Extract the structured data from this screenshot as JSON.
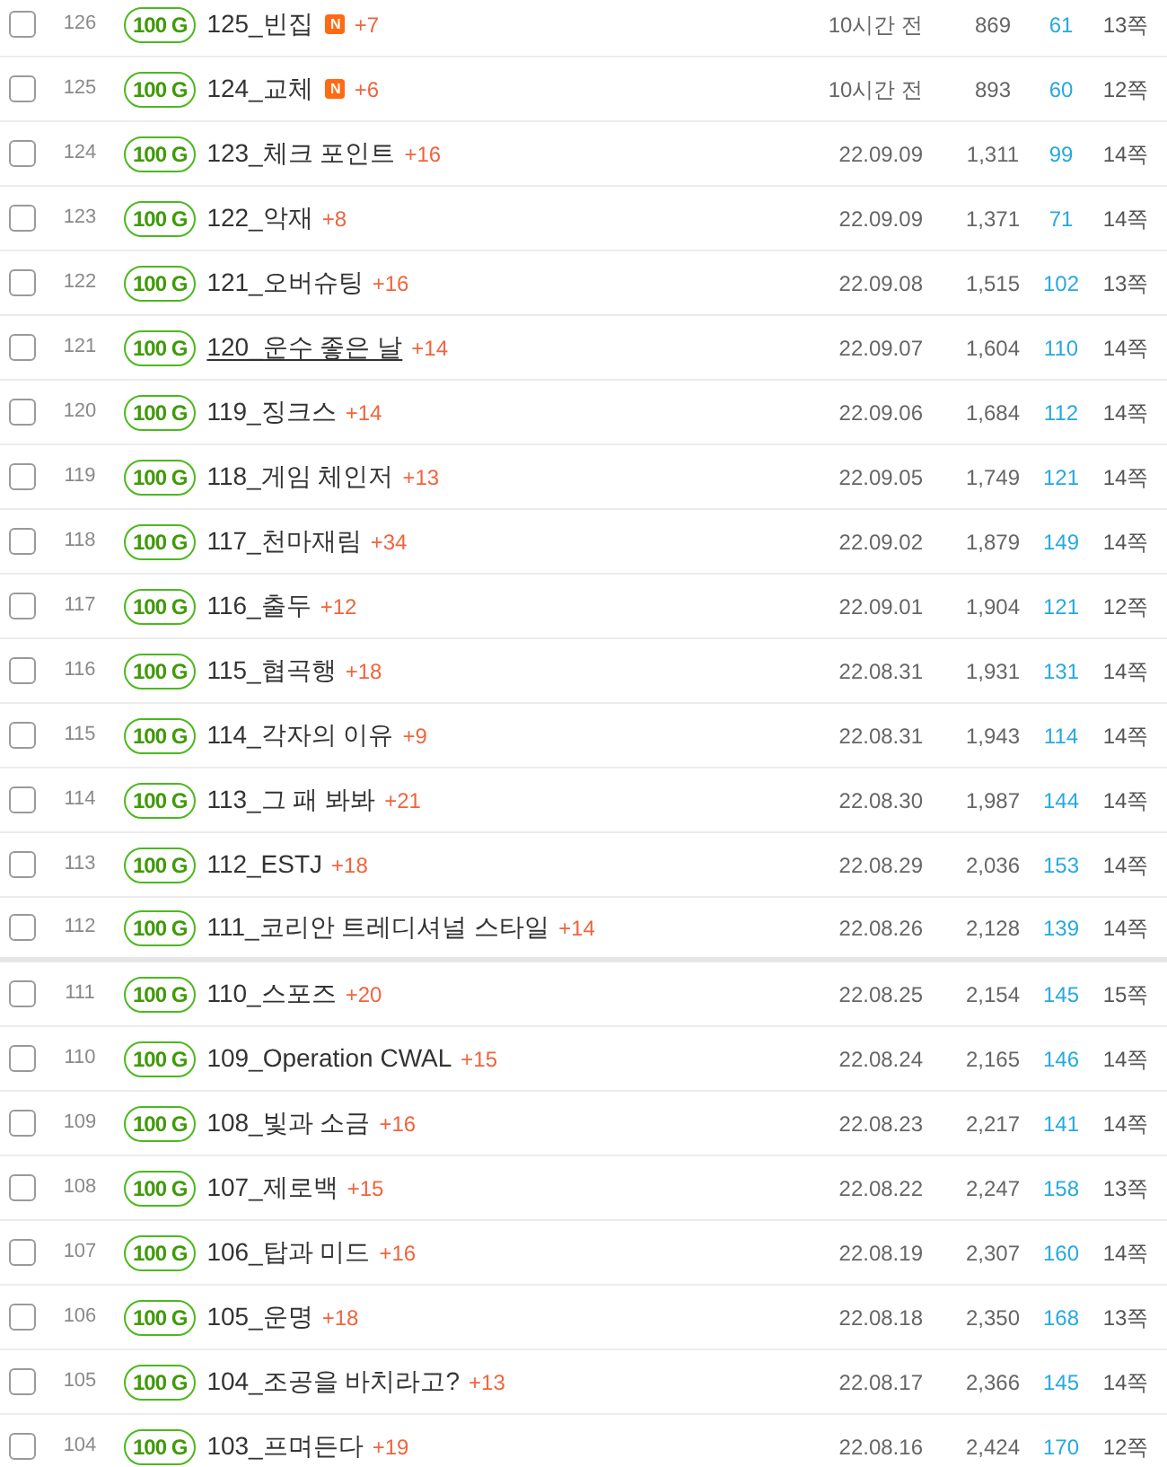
{
  "rows": [
    {
      "checked": false,
      "number": "126",
      "price": "100 G",
      "title": "125_빈집",
      "hovered": false,
      "badge": "N",
      "count": "+7",
      "date": "10시간 전",
      "views": "869",
      "likes": "61",
      "pages": "13쪽",
      "group_end": false
    },
    {
      "checked": false,
      "number": "125",
      "price": "100 G",
      "title": "124_교체",
      "hovered": false,
      "badge": "N",
      "count": "+6",
      "date": "10시간 전",
      "views": "893",
      "likes": "60",
      "pages": "12쪽",
      "group_end": false
    },
    {
      "checked": false,
      "number": "124",
      "price": "100 G",
      "title": "123_체크 포인트",
      "hovered": false,
      "count": "+16",
      "date": "22.09.09",
      "views": "1,311",
      "likes": "99",
      "pages": "14쪽",
      "group_end": false
    },
    {
      "checked": false,
      "number": "123",
      "price": "100 G",
      "title": "122_악재",
      "hovered": false,
      "count": "+8",
      "date": "22.09.09",
      "views": "1,371",
      "likes": "71",
      "pages": "14쪽",
      "group_end": false
    },
    {
      "checked": false,
      "number": "122",
      "price": "100 G",
      "title": "121_오버슈팅",
      "hovered": false,
      "count": "+16",
      "date": "22.09.08",
      "views": "1,515",
      "likes": "102",
      "pages": "13쪽",
      "group_end": false
    },
    {
      "checked": false,
      "number": "121",
      "price": "100 G",
      "title": "120_운수 좋은 날",
      "hovered": true,
      "count": "+14",
      "date": "22.09.07",
      "views": "1,604",
      "likes": "110",
      "pages": "14쪽",
      "group_end": false
    },
    {
      "checked": false,
      "number": "120",
      "price": "100 G",
      "title": "119_징크스",
      "hovered": false,
      "count": "+14",
      "date": "22.09.06",
      "views": "1,684",
      "likes": "112",
      "pages": "14쪽",
      "group_end": false
    },
    {
      "checked": false,
      "number": "119",
      "price": "100 G",
      "title": "118_게임 체인저",
      "hovered": false,
      "count": "+13",
      "date": "22.09.05",
      "views": "1,749",
      "likes": "121",
      "pages": "14쪽",
      "group_end": false
    },
    {
      "checked": false,
      "number": "118",
      "price": "100 G",
      "title": "117_천마재림",
      "hovered": false,
      "count": "+34",
      "date": "22.09.02",
      "views": "1,879",
      "likes": "149",
      "pages": "14쪽",
      "group_end": false
    },
    {
      "checked": false,
      "number": "117",
      "price": "100 G",
      "title": "116_출두",
      "hovered": false,
      "count": "+12",
      "date": "22.09.01",
      "views": "1,904",
      "likes": "121",
      "pages": "12쪽",
      "group_end": false
    },
    {
      "checked": false,
      "number": "116",
      "price": "100 G",
      "title": "115_협곡행",
      "hovered": false,
      "count": "+18",
      "date": "22.08.31",
      "views": "1,931",
      "likes": "131",
      "pages": "14쪽",
      "group_end": false
    },
    {
      "checked": false,
      "number": "115",
      "price": "100 G",
      "title": "114_각자의 이유",
      "hovered": false,
      "count": "+9",
      "date": "22.08.31",
      "views": "1,943",
      "likes": "114",
      "pages": "14쪽",
      "group_end": false
    },
    {
      "checked": false,
      "number": "114",
      "price": "100 G",
      "title": "113_그 패 봐봐",
      "hovered": false,
      "count": "+21",
      "date": "22.08.30",
      "views": "1,987",
      "likes": "144",
      "pages": "14쪽",
      "group_end": false
    },
    {
      "checked": false,
      "number": "113",
      "price": "100 G",
      "title": "112_ESTJ",
      "hovered": false,
      "count": "+18",
      "date": "22.08.29",
      "views": "2,036",
      "likes": "153",
      "pages": "14쪽",
      "group_end": false
    },
    {
      "checked": false,
      "number": "112",
      "price": "100 G",
      "title": "111_코리안 트레디셔널 스타일",
      "hovered": false,
      "count": "+14",
      "date": "22.08.26",
      "views": "2,128",
      "likes": "139",
      "pages": "14쪽",
      "group_end": true
    },
    {
      "checked": false,
      "number": "111",
      "price": "100 G",
      "title": "110_스포즈",
      "hovered": false,
      "count": "+20",
      "date": "22.08.25",
      "views": "2,154",
      "likes": "145",
      "pages": "15쪽",
      "group_end": false
    },
    {
      "checked": false,
      "number": "110",
      "price": "100 G",
      "title": "109_Operation CWAL",
      "hovered": false,
      "count": "+15",
      "date": "22.08.24",
      "views": "2,165",
      "likes": "146",
      "pages": "14쪽",
      "group_end": false
    },
    {
      "checked": false,
      "number": "109",
      "price": "100 G",
      "title": "108_빛과 소금",
      "hovered": false,
      "count": "+16",
      "date": "22.08.23",
      "views": "2,217",
      "likes": "141",
      "pages": "14쪽",
      "group_end": false
    },
    {
      "checked": false,
      "number": "108",
      "price": "100 G",
      "title": "107_제로백",
      "hovered": false,
      "count": "+15",
      "date": "22.08.22",
      "views": "2,247",
      "likes": "158",
      "pages": "13쪽",
      "group_end": false
    },
    {
      "checked": false,
      "number": "107",
      "price": "100 G",
      "title": "106_탑과 미드",
      "hovered": false,
      "count": "+16",
      "date": "22.08.19",
      "views": "2,307",
      "likes": "160",
      "pages": "14쪽",
      "group_end": false
    },
    {
      "checked": false,
      "number": "106",
      "price": "100 G",
      "title": "105_운명",
      "hovered": false,
      "count": "+18",
      "date": "22.08.18",
      "views": "2,350",
      "likes": "168",
      "pages": "13쪽",
      "group_end": false
    },
    {
      "checked": false,
      "number": "105",
      "price": "100 G",
      "title": "104_조공을 바치라고?",
      "hovered": false,
      "count": "+13",
      "date": "22.08.17",
      "views": "2,366",
      "likes": "145",
      "pages": "14쪽",
      "group_end": false
    },
    {
      "checked": false,
      "number": "104",
      "price": "100 G",
      "title": "103_프며든다",
      "hovered": false,
      "count": "+19",
      "date": "22.08.16",
      "views": "2,424",
      "likes": "170",
      "pages": "12쪽",
      "group_end": false
    }
  ]
}
